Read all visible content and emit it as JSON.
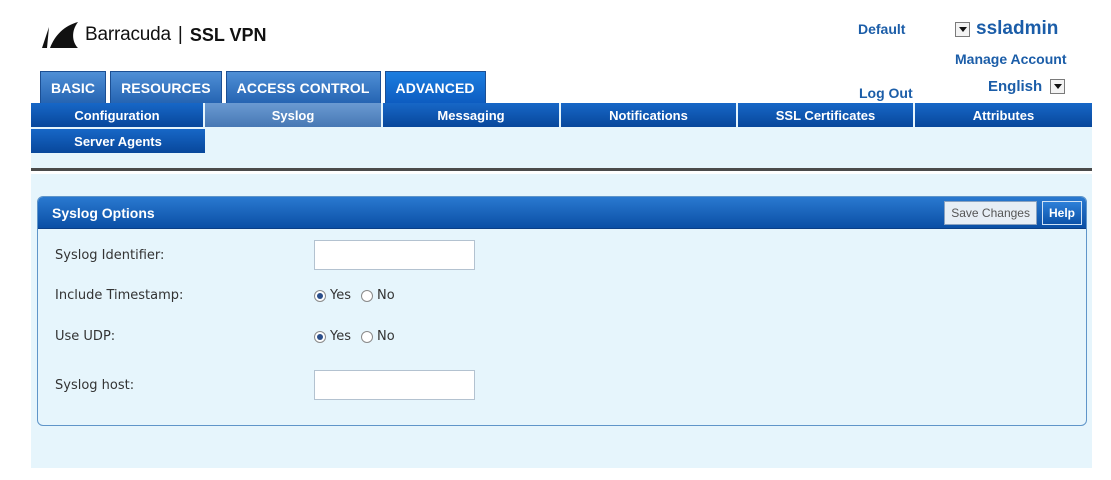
{
  "brand": {
    "name": "Barracuda",
    "separator": "|",
    "product": "SSL VPN"
  },
  "header": {
    "default_label": "Default",
    "user": "ssladmin",
    "manage_account": "Manage Account",
    "logout": "Log Out",
    "language": "English"
  },
  "main_tabs": [
    {
      "label": "BASIC"
    },
    {
      "label": "RESOURCES"
    },
    {
      "label": "ACCESS CONTROL"
    },
    {
      "label": "ADVANCED",
      "active": true
    }
  ],
  "sub_tabs": [
    {
      "label": "Configuration"
    },
    {
      "label": "Syslog",
      "active": true
    },
    {
      "label": "Messaging"
    },
    {
      "label": "Notifications"
    },
    {
      "label": "SSL Certificates"
    },
    {
      "label": "Attributes"
    },
    {
      "label": "Server Agents"
    }
  ],
  "panel": {
    "title": "Syslog Options",
    "save_label": "Save Changes",
    "help_label": "Help",
    "fields": {
      "identifier": {
        "label": "Syslog Identifier:",
        "value": ""
      },
      "timestamp": {
        "label": "Include Timestamp:",
        "yes": "Yes",
        "no": "No",
        "selected": "Yes"
      },
      "udp": {
        "label": "Use UDP:",
        "yes": "Yes",
        "no": "No",
        "selected": "Yes"
      },
      "host": {
        "label": "Syslog host:",
        "value": ""
      }
    }
  },
  "colors": {
    "link": "#1b5da8",
    "tab": "#2564b2",
    "subnav": "#0d55ad",
    "panel_bg": "#e6f5fc"
  }
}
